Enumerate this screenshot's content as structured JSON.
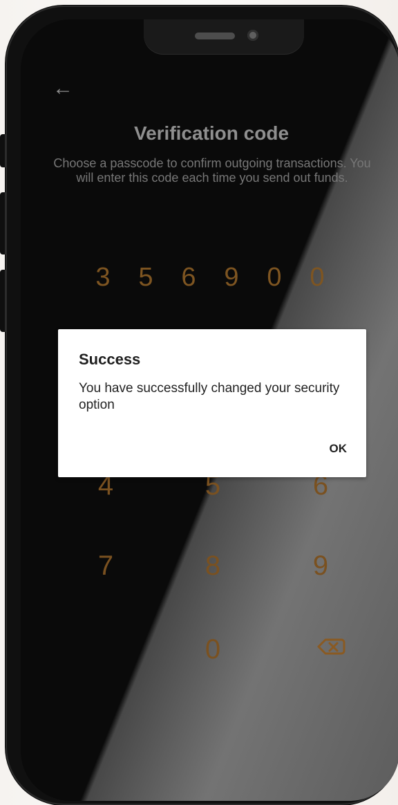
{
  "screen": {
    "title": "Verification code",
    "subtitle": "Choose a passcode to confirm outgoing transactions. You will enter this code each time you send out funds."
  },
  "passcode": {
    "digits": [
      "3",
      "5",
      "6",
      "9",
      "0",
      "0"
    ]
  },
  "keypad": {
    "visible_keys": [
      "4",
      "5",
      "6",
      "7",
      "8",
      "9",
      "0"
    ],
    "backspace_icon": "backspace-icon"
  },
  "dialog": {
    "title": "Success",
    "message": "You have successfully changed your security option",
    "ok_label": "OK"
  },
  "icons": {
    "back": "arrow-left-icon",
    "backspace": "backspace-icon"
  },
  "colors": {
    "accent": "#7a5120",
    "dialog_background": "#ffffff",
    "text_muted": "#8f8f8f"
  }
}
